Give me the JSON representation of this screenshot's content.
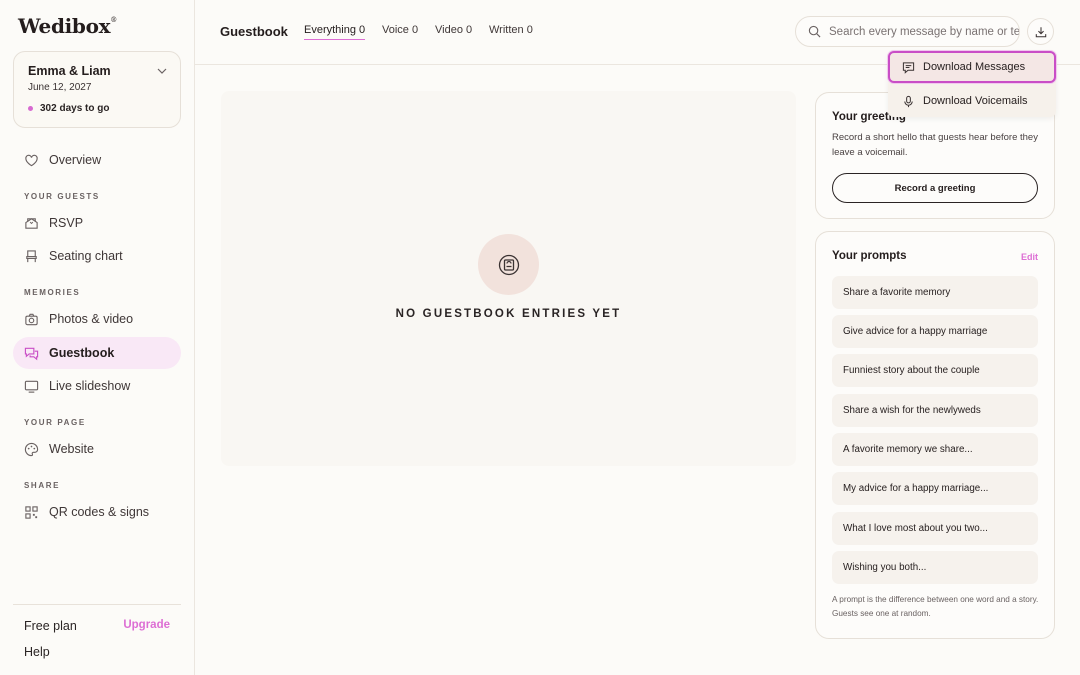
{
  "app": {
    "logo": "Wedibox",
    "logo_mark": "®"
  },
  "event": {
    "name": "Emma & Liam",
    "date": "June 12, 2027",
    "countdown": "302 days to go"
  },
  "sidebar": {
    "overview": "Overview",
    "sections": {
      "guests": "YOUR GUESTS",
      "memories": "MEMORIES",
      "page": "YOUR PAGE",
      "share": "SHARE"
    },
    "items": {
      "rsvp": "RSVP",
      "seating": "Seating chart",
      "photos": "Photos & video",
      "guestbook": "Guestbook",
      "slideshow": "Live slideshow",
      "website": "Website",
      "qr": "QR codes & signs"
    },
    "plan": "Free plan",
    "upgrade": "Upgrade",
    "help": "Help"
  },
  "header": {
    "title": "Guestbook",
    "tabs": [
      {
        "label": "Everything 0"
      },
      {
        "label": "Voice 0"
      },
      {
        "label": "Video 0"
      },
      {
        "label": "Written 0"
      }
    ],
    "search_placeholder": "Search every message by name or text"
  },
  "dropdown": {
    "items": [
      "Download Messages",
      "Download Voicemails"
    ]
  },
  "main": {
    "empty_text": "NO GUESTBOOK ENTRIES YET"
  },
  "greeting": {
    "title": "Your greeting",
    "description": "Record a short hello that guests hear before they leave a voicemail.",
    "button": "Record a greeting"
  },
  "prompts": {
    "title": "Your prompts",
    "edit": "Edit",
    "items": [
      "Share a favorite memory",
      "Give advice for a happy marriage",
      "Funniest story about the couple",
      "Share a wish for the newlyweds",
      "A favorite memory we share...",
      "My advice for a happy marriage...",
      "What I love most about you two...",
      "Wishing you both..."
    ],
    "footnote": "A prompt is the difference between one word and a story. Guests see one at random."
  },
  "colors": {
    "accent": "#dd6ed4",
    "active_bg": "#f9e8f6",
    "highlight_border": "#c94ec6"
  }
}
